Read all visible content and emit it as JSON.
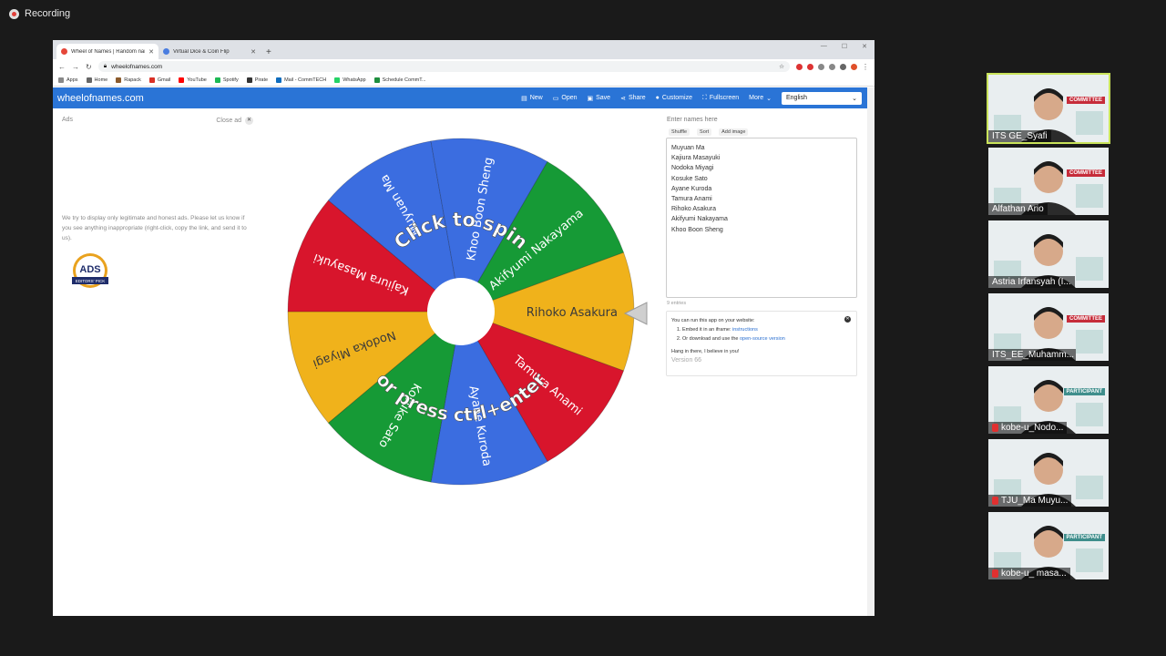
{
  "recording": {
    "label": "Recording"
  },
  "browser": {
    "tabs": [
      {
        "title": "Wheel of Names | Random nam",
        "active": true,
        "fav_color": "#e5473a"
      },
      {
        "title": "Virtual Dice & Coin Flip",
        "active": false,
        "fav_color": "#4a7de0"
      }
    ],
    "url": "wheelofnames.com",
    "bookmarks": [
      {
        "label": "Apps",
        "color": "#888"
      },
      {
        "label": "Home",
        "color": "#666"
      },
      {
        "label": "Rapack",
        "color": "#8b5a2b"
      },
      {
        "label": "Gmail",
        "color": "#d93025"
      },
      {
        "label": "YouTube",
        "color": "#ff0000"
      },
      {
        "label": "Spotify",
        "color": "#1db954"
      },
      {
        "label": "Pirate",
        "color": "#333"
      },
      {
        "label": "Mail - CommTECH",
        "color": "#0f6cbd"
      },
      {
        "label": "WhatsApp",
        "color": "#25d366"
      },
      {
        "label": "Schedule CommT...",
        "color": "#1e8e3e"
      }
    ]
  },
  "site": {
    "brand": "wheelofnames.com",
    "nav": [
      {
        "label": "New",
        "icon": "file-icon"
      },
      {
        "label": "Open",
        "icon": "folder-icon"
      },
      {
        "label": "Save",
        "icon": "save-icon"
      },
      {
        "label": "Share",
        "icon": "share-icon"
      },
      {
        "label": "Customize",
        "icon": "palette-icon"
      },
      {
        "label": "Fullscreen",
        "icon": "fullscreen-icon"
      },
      {
        "label": "More",
        "icon": "chevron-down-icon"
      }
    ],
    "language": "English"
  },
  "ads": {
    "label": "Ads",
    "close_label": "Close ad",
    "text": "We try to display only legitimate and honest ads. Please let us know if you see anything inappropriate (right-click, copy the link, and send it to us).",
    "badge_top": "ADS",
    "badge_bottom": "EDITORS' PICK"
  },
  "wheel": {
    "top_text": "Click to spin",
    "bottom_text": "or press ctrl+enter",
    "segments": [
      {
        "name": "Rihoko Asakura",
        "color": "#f0b21b"
      },
      {
        "name": "Tamura Anami",
        "color": "#d8152c"
      },
      {
        "name": "Ayane Kuroda",
        "color": "#3b6de0"
      },
      {
        "name": "Kosuke Sato",
        "color": "#169a36"
      },
      {
        "name": "Nodoka Miyagi",
        "color": "#f0b21b"
      },
      {
        "name": "Kajiura Masayuki",
        "color": "#d8152c"
      },
      {
        "name": "Muyuan Ma",
        "color": "#3b6de0"
      },
      {
        "name": "Khoo Boon Sheng",
        "color": "#3b6de0"
      },
      {
        "name": "Akifyumi Nakayama",
        "color": "#169a36"
      }
    ]
  },
  "entries": {
    "label": "Enter names here",
    "tools": [
      "Shuffle",
      "Sort",
      "Add image"
    ],
    "names": [
      "Muyuan Ma",
      "Kajiura Masayuki",
      "Nodoka Miyagi",
      "Kosuke Sato",
      "Ayane Kuroda",
      "Tamura Anami",
      "Rihoko Asakura",
      "Akifyumi Nakayama",
      "Khoo Boon Sheng"
    ],
    "count": "9 entries"
  },
  "info": {
    "intro": "You can run this app on your website:",
    "item1_prefix": "Embed it in an iframe: ",
    "item1_link": "instructions",
    "item2_prefix": "Or download and use the ",
    "item2_link": "open-source version",
    "hang": "Hang in there, I believe in you!",
    "version": "Version 66"
  },
  "participants": [
    {
      "name": "ITS GE_Syafi",
      "tag": "COMMITTEE",
      "active": true,
      "muted": false
    },
    {
      "name": "Alfathan Ario",
      "tag": "COMMITTEE",
      "active": false,
      "muted": false
    },
    {
      "name": "Astria Irfansyah (I...",
      "tag": "",
      "active": false,
      "muted": false
    },
    {
      "name": "ITS_EE_Muhamm...",
      "tag": "COMMITTEE",
      "active": false,
      "muted": false
    },
    {
      "name": "kobe-u_Nodo...",
      "tag": "PARTICIPANT",
      "active": false,
      "muted": true
    },
    {
      "name": "TJU_Ma Muyu...",
      "tag": "",
      "active": false,
      "muted": true
    },
    {
      "name": "kobe-u_ masa...",
      "tag": "PARTICIPANT",
      "active": false,
      "muted": true
    }
  ]
}
